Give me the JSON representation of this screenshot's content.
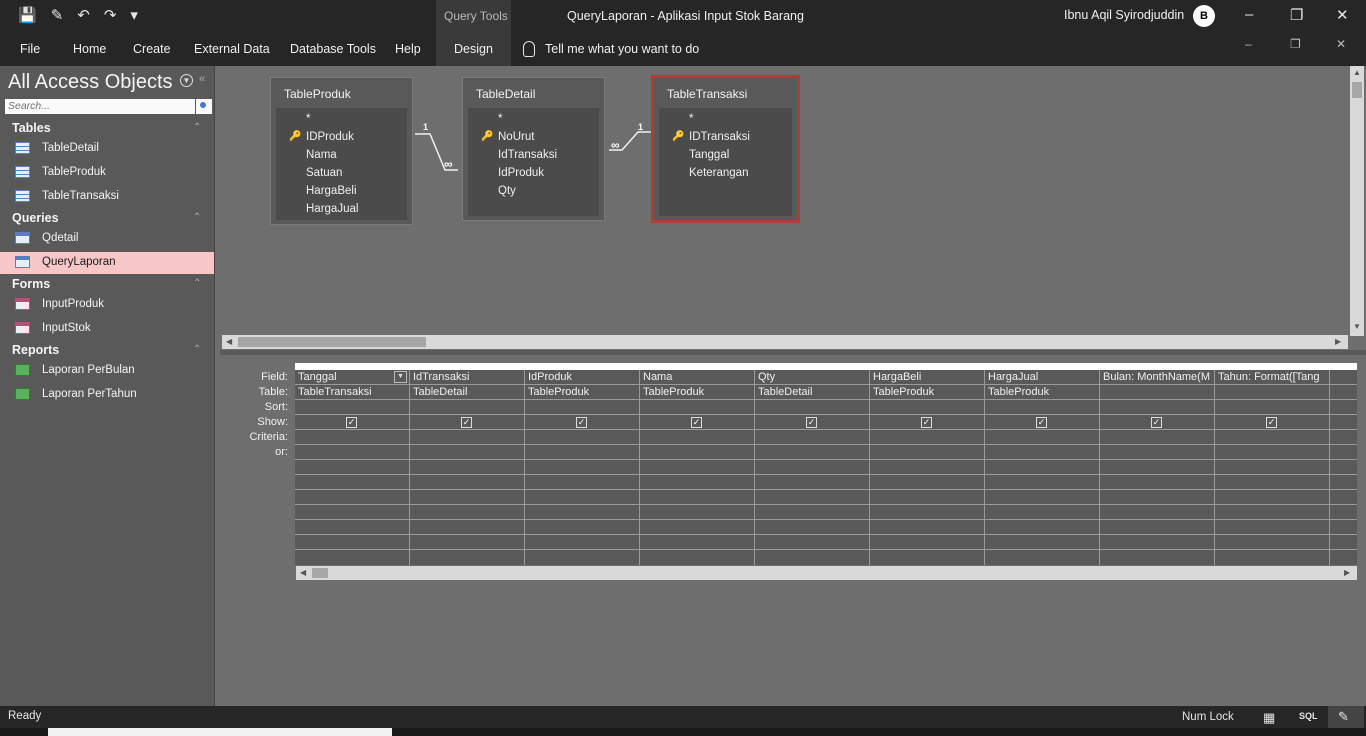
{
  "titlebar": {
    "context_tab": "Query Tools",
    "title": "QueryLaporan  -  Aplikasi Input Stok Barang",
    "user": "Ibnu Aqil Syirodjuddin",
    "avatar": "B"
  },
  "qat": [
    "save-icon",
    "edit-icon",
    "undo-icon",
    "redo-icon",
    "customize-icon"
  ],
  "ribbon": {
    "tabs": [
      "File",
      "Home",
      "Create",
      "External Data",
      "Database Tools",
      "Help",
      "Design"
    ],
    "tellme": "Tell me what you want to do"
  },
  "nav": {
    "title": "All Access Objects",
    "search_placeholder": "Search...",
    "groups": {
      "tables": "Tables",
      "queries": "Queries",
      "forms": "Forms",
      "reports": "Reports"
    },
    "items": {
      "tabledetail": "TableDetail",
      "tableproduk": "TableProduk",
      "tabletransaksi": "TableTransaksi",
      "qdetail": "Qdetail",
      "querylaporan": "QueryLaporan",
      "inputproduk": "InputProduk",
      "inputstok": "InputStok",
      "laporanperbulan": "Laporan PerBulan",
      "laporanpertahun": "Laporan PerTahun"
    }
  },
  "tables": {
    "produk": {
      "title": "TableProduk",
      "fields": [
        "*",
        "IDProduk",
        "Nama",
        "Satuan",
        "HargaBeli",
        "HargaJual"
      ]
    },
    "detail": {
      "title": "TableDetail",
      "fields": [
        "*",
        "NoUrut",
        "IdTransaksi",
        "IdProduk",
        "Qty"
      ]
    },
    "transaksi": {
      "title": "TableTransaksi",
      "fields": [
        "*",
        "IDTransaksi",
        "Tanggal",
        "Keterangan"
      ]
    }
  },
  "relations": {
    "one": "1",
    "many": "∞"
  },
  "grid": {
    "row_labels": [
      "Field:",
      "Table:",
      "Sort:",
      "Show:",
      "Criteria:",
      "or:"
    ],
    "columns": [
      {
        "field": "Tanggal",
        "table": "TableTransaksi"
      },
      {
        "field": "IdTransaksi",
        "table": "TableDetail"
      },
      {
        "field": "IdProduk",
        "table": "TableProduk"
      },
      {
        "field": "Nama",
        "table": "TableProduk"
      },
      {
        "field": "Qty",
        "table": "TableDetail"
      },
      {
        "field": "HargaBeli",
        "table": "TableProduk"
      },
      {
        "field": "HargaJual",
        "table": "TableProduk"
      },
      {
        "field": "Bulan: MonthName(M",
        "table": ""
      },
      {
        "field": "Tahun: Format([Tang",
        "table": ""
      }
    ]
  },
  "status": {
    "ready": "Ready",
    "numlock": "Num Lock",
    "sql": "SQL"
  }
}
